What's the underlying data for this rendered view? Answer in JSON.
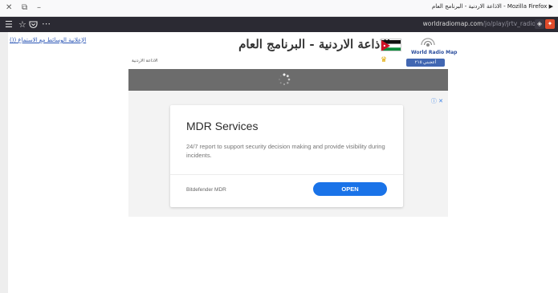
{
  "window": {
    "title": "Mozilla Firefox - الاذاعة الاردنية - البرنامج العام",
    "close_glyph": "✕",
    "restore_glyph": "⧉",
    "minimize_glyph": "–",
    "play_glyph": "▶"
  },
  "toolbar": {
    "url_host": "worldradiomap.com",
    "url_path": "/jo/play/jrtv_radio"
  },
  "page": {
    "listen_link": "الإعلانية الوسائط مع الاستماع (()",
    "title": "الاذاعة الاردنية - البرنامج العام",
    "logo_text": "World Radio Map",
    "like_button": "أعجبني ٢١٥",
    "breadcrumb": "الاذاعة الاردنية"
  },
  "ad": {
    "headline": "MDR Services",
    "body": "24/7 report to support security decision making and provide visibility during incidents.",
    "brand": "Bitdefender MDR",
    "cta": "OPEN",
    "adchoice": "ⓘ ✕"
  },
  "colors": {
    "toolbar_bg": "#2b2a33",
    "player_bg": "#6c6c6c",
    "cta_blue": "#1a73e8",
    "like_blue": "#4267b2"
  },
  "icons": {
    "menu": "hamburger-icon",
    "star": "bookmark-star-icon",
    "pocket": "pocket-icon",
    "more": "more-icon"
  }
}
